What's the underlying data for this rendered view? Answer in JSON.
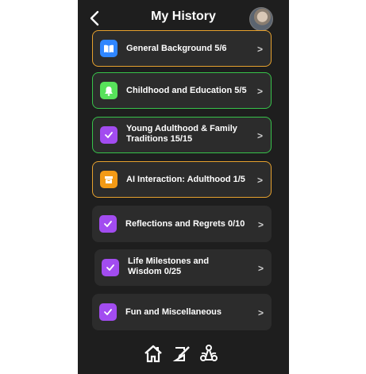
{
  "header": {
    "title": "My History"
  },
  "colors": {
    "background": "#1e1e1e",
    "card": "#2c2c2c",
    "border_orange": "#e6a12e",
    "border_green": "#37c24a",
    "icon_blue": "#2f86ff",
    "icon_green": "#57e25a",
    "icon_purple": "#a24cf0",
    "icon_orange": "#f39a16"
  },
  "items": [
    {
      "label": "General Background 5/6",
      "icon": "book-icon"
    },
    {
      "label": "Childhood and Education 5/5",
      "icon": "bell-icon"
    },
    {
      "label": "Young Adulthood & Family Traditions 15/15",
      "icon": "check-icon"
    },
    {
      "label": "AI Interaction: Adulthood 1/5",
      "icon": "box-icon"
    },
    {
      "label": "Reflections and Regrets 0/10",
      "icon": "check-icon"
    },
    {
      "label": "Life Milestones and Wisdom 0/25",
      "icon": "check-icon"
    },
    {
      "label": "Fun and Miscellaneous",
      "icon": "check-icon"
    }
  ],
  "chevron": ">",
  "nav": {
    "icons": [
      "home-icon",
      "edit-document-icon",
      "share-network-icon"
    ]
  }
}
